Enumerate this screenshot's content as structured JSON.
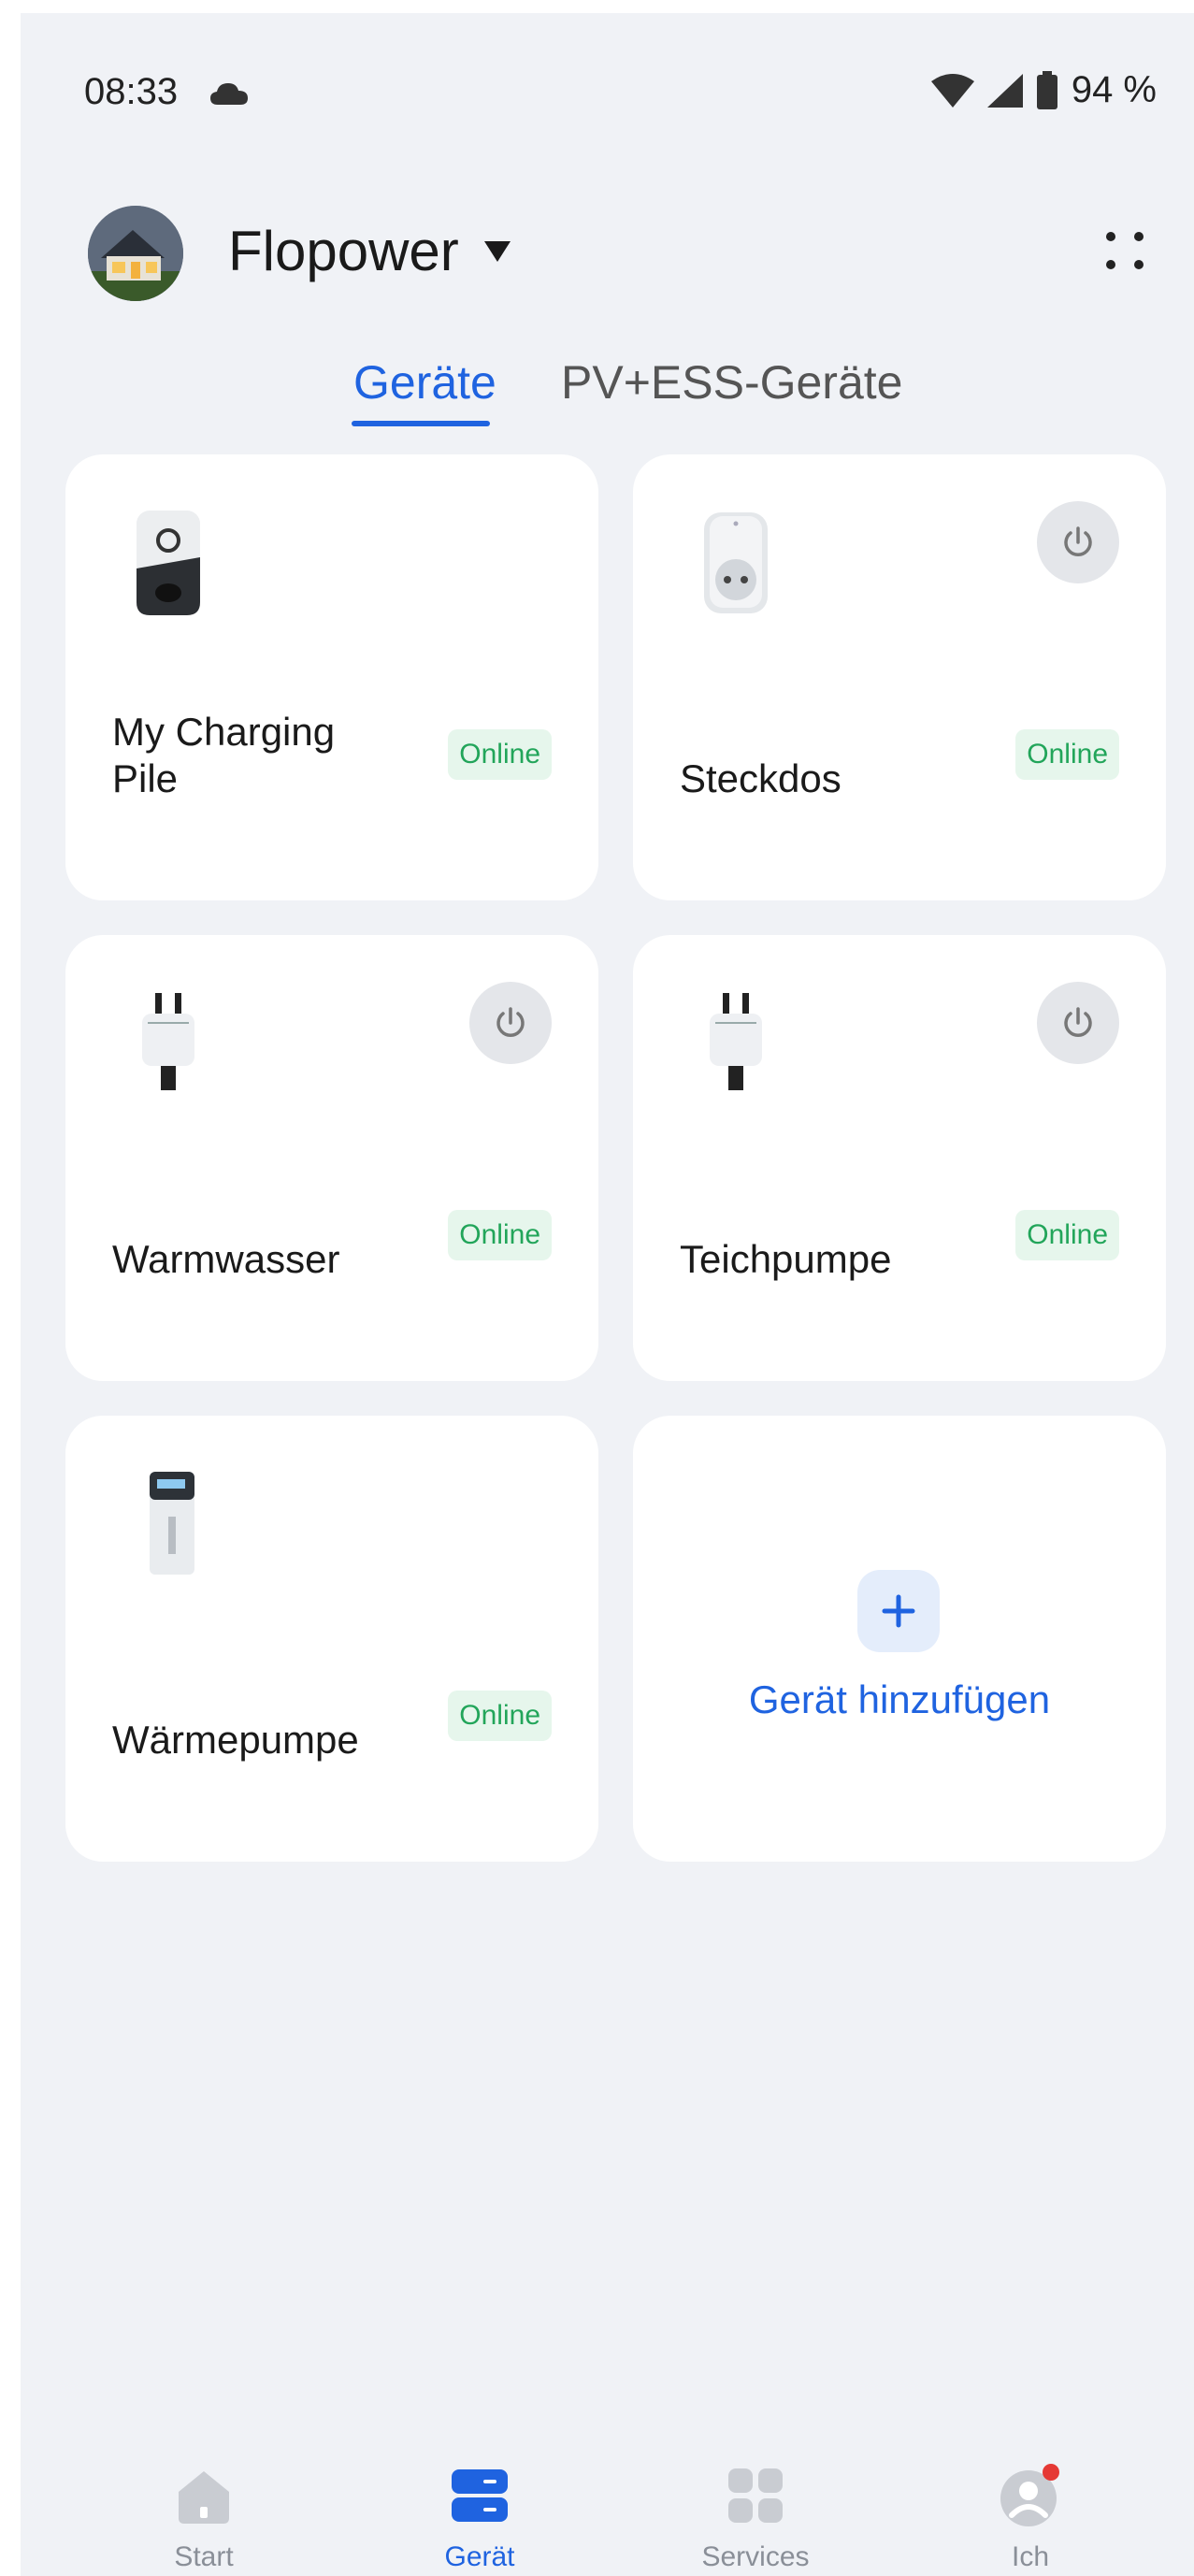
{
  "status_bar": {
    "time": "08:33",
    "battery": "94 %",
    "icons": [
      "cloud-icon",
      "wifi-icon",
      "cell-signal-icon",
      "battery-icon"
    ]
  },
  "header": {
    "home_name": "Flopower",
    "avatar": "house-photo-avatar",
    "more_icon": "more-dots-icon"
  },
  "tabs": [
    {
      "label": "Geräte",
      "active": true
    },
    {
      "label": "PV+ESS-Geräte",
      "active": false
    }
  ],
  "devices": [
    {
      "name": "My Charging Pile",
      "status": "Online",
      "icon": "charging-pile-icon",
      "has_power": false
    },
    {
      "name": "Steckdos",
      "status": "Online",
      "icon": "smart-socket-icon",
      "has_power": true
    },
    {
      "name": "Warmwasser",
      "status": "Online",
      "icon": "smart-plug-icon",
      "has_power": true
    },
    {
      "name": "Teichpumpe",
      "status": "Online",
      "icon": "smart-plug-icon",
      "has_power": true
    },
    {
      "name": "Wärmepumpe",
      "status": "Online",
      "icon": "heat-pump-icon",
      "has_power": false
    }
  ],
  "add_device": {
    "label": "Gerät hinzufügen"
  },
  "bottom_nav": [
    {
      "label": "Start",
      "icon": "home-icon",
      "active": false
    },
    {
      "label": "Gerät",
      "icon": "device-icon",
      "active": true
    },
    {
      "label": "Services",
      "icon": "services-grid-icon",
      "active": false
    },
    {
      "label": "Ich",
      "icon": "profile-icon",
      "active": false,
      "notification_dot": true
    }
  ],
  "colors": {
    "accent": "#1f63e0",
    "online_text": "#22a55a",
    "online_bg": "#e6f6ec",
    "background": "#f0f2f6",
    "notification": "#e53935"
  }
}
